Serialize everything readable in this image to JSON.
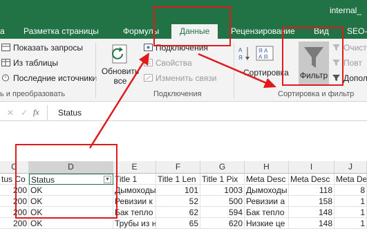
{
  "window": {
    "filename": "internal_"
  },
  "tabs": [
    {
      "label": "а"
    },
    {
      "label": "Разметка страницы"
    },
    {
      "label": "Формулы"
    },
    {
      "label": "Данные"
    },
    {
      "label": "Рецензирование"
    },
    {
      "label": "Вид"
    },
    {
      "label": "SEO-Б"
    }
  ],
  "ribbon": {
    "get_transform": {
      "show_queries": "Показать запросы",
      "from_table": "Из таблицы",
      "recent_sources": "Последние источники",
      "group_label": "ь и преобразовать"
    },
    "connections": {
      "refresh_all": [
        "Обновить",
        "все"
      ],
      "connections": "Подключения",
      "properties": "Свойства",
      "edit_links": "Изменить связи",
      "group_label": "Подключения"
    },
    "sort_filter": {
      "sort": "Сортировка",
      "filter": "Фильтр",
      "clear": "Очист",
      "reapply": "Повт",
      "advanced": "Допол",
      "group_label": "Сортировка и фильтр"
    }
  },
  "formula_bar": {
    "fx": "fx",
    "cancel": "✕",
    "enter": "✓",
    "value": "Status"
  },
  "sheet": {
    "columns": [
      "C",
      "D",
      "E",
      "F",
      "G",
      "H",
      "I",
      "J"
    ],
    "header_row": [
      "tus Co",
      "Status",
      "Title 1",
      "Title 1 Len",
      "Title 1 Pix",
      "Meta Desc",
      "Meta Desc",
      "Meta Desc"
    ],
    "rows": [
      [
        "200",
        "OK",
        "Дымоходы",
        "101",
        "1003",
        "Дымоходы",
        "118",
        "8"
      ],
      [
        "200",
        "OK",
        "Ревизии к",
        "52",
        "500",
        "Ревизии а",
        "158",
        "1"
      ],
      [
        "200",
        "OK",
        "Бак тепло",
        "62",
        "594",
        "Бак тепло",
        "148",
        "1"
      ],
      [
        "200",
        "OK",
        "Трубы из н",
        "65",
        "620",
        "Низкие це",
        "148",
        "1"
      ]
    ]
  },
  "colors": {
    "excel_green": "#217346",
    "highlight_red": "#e0191a"
  }
}
